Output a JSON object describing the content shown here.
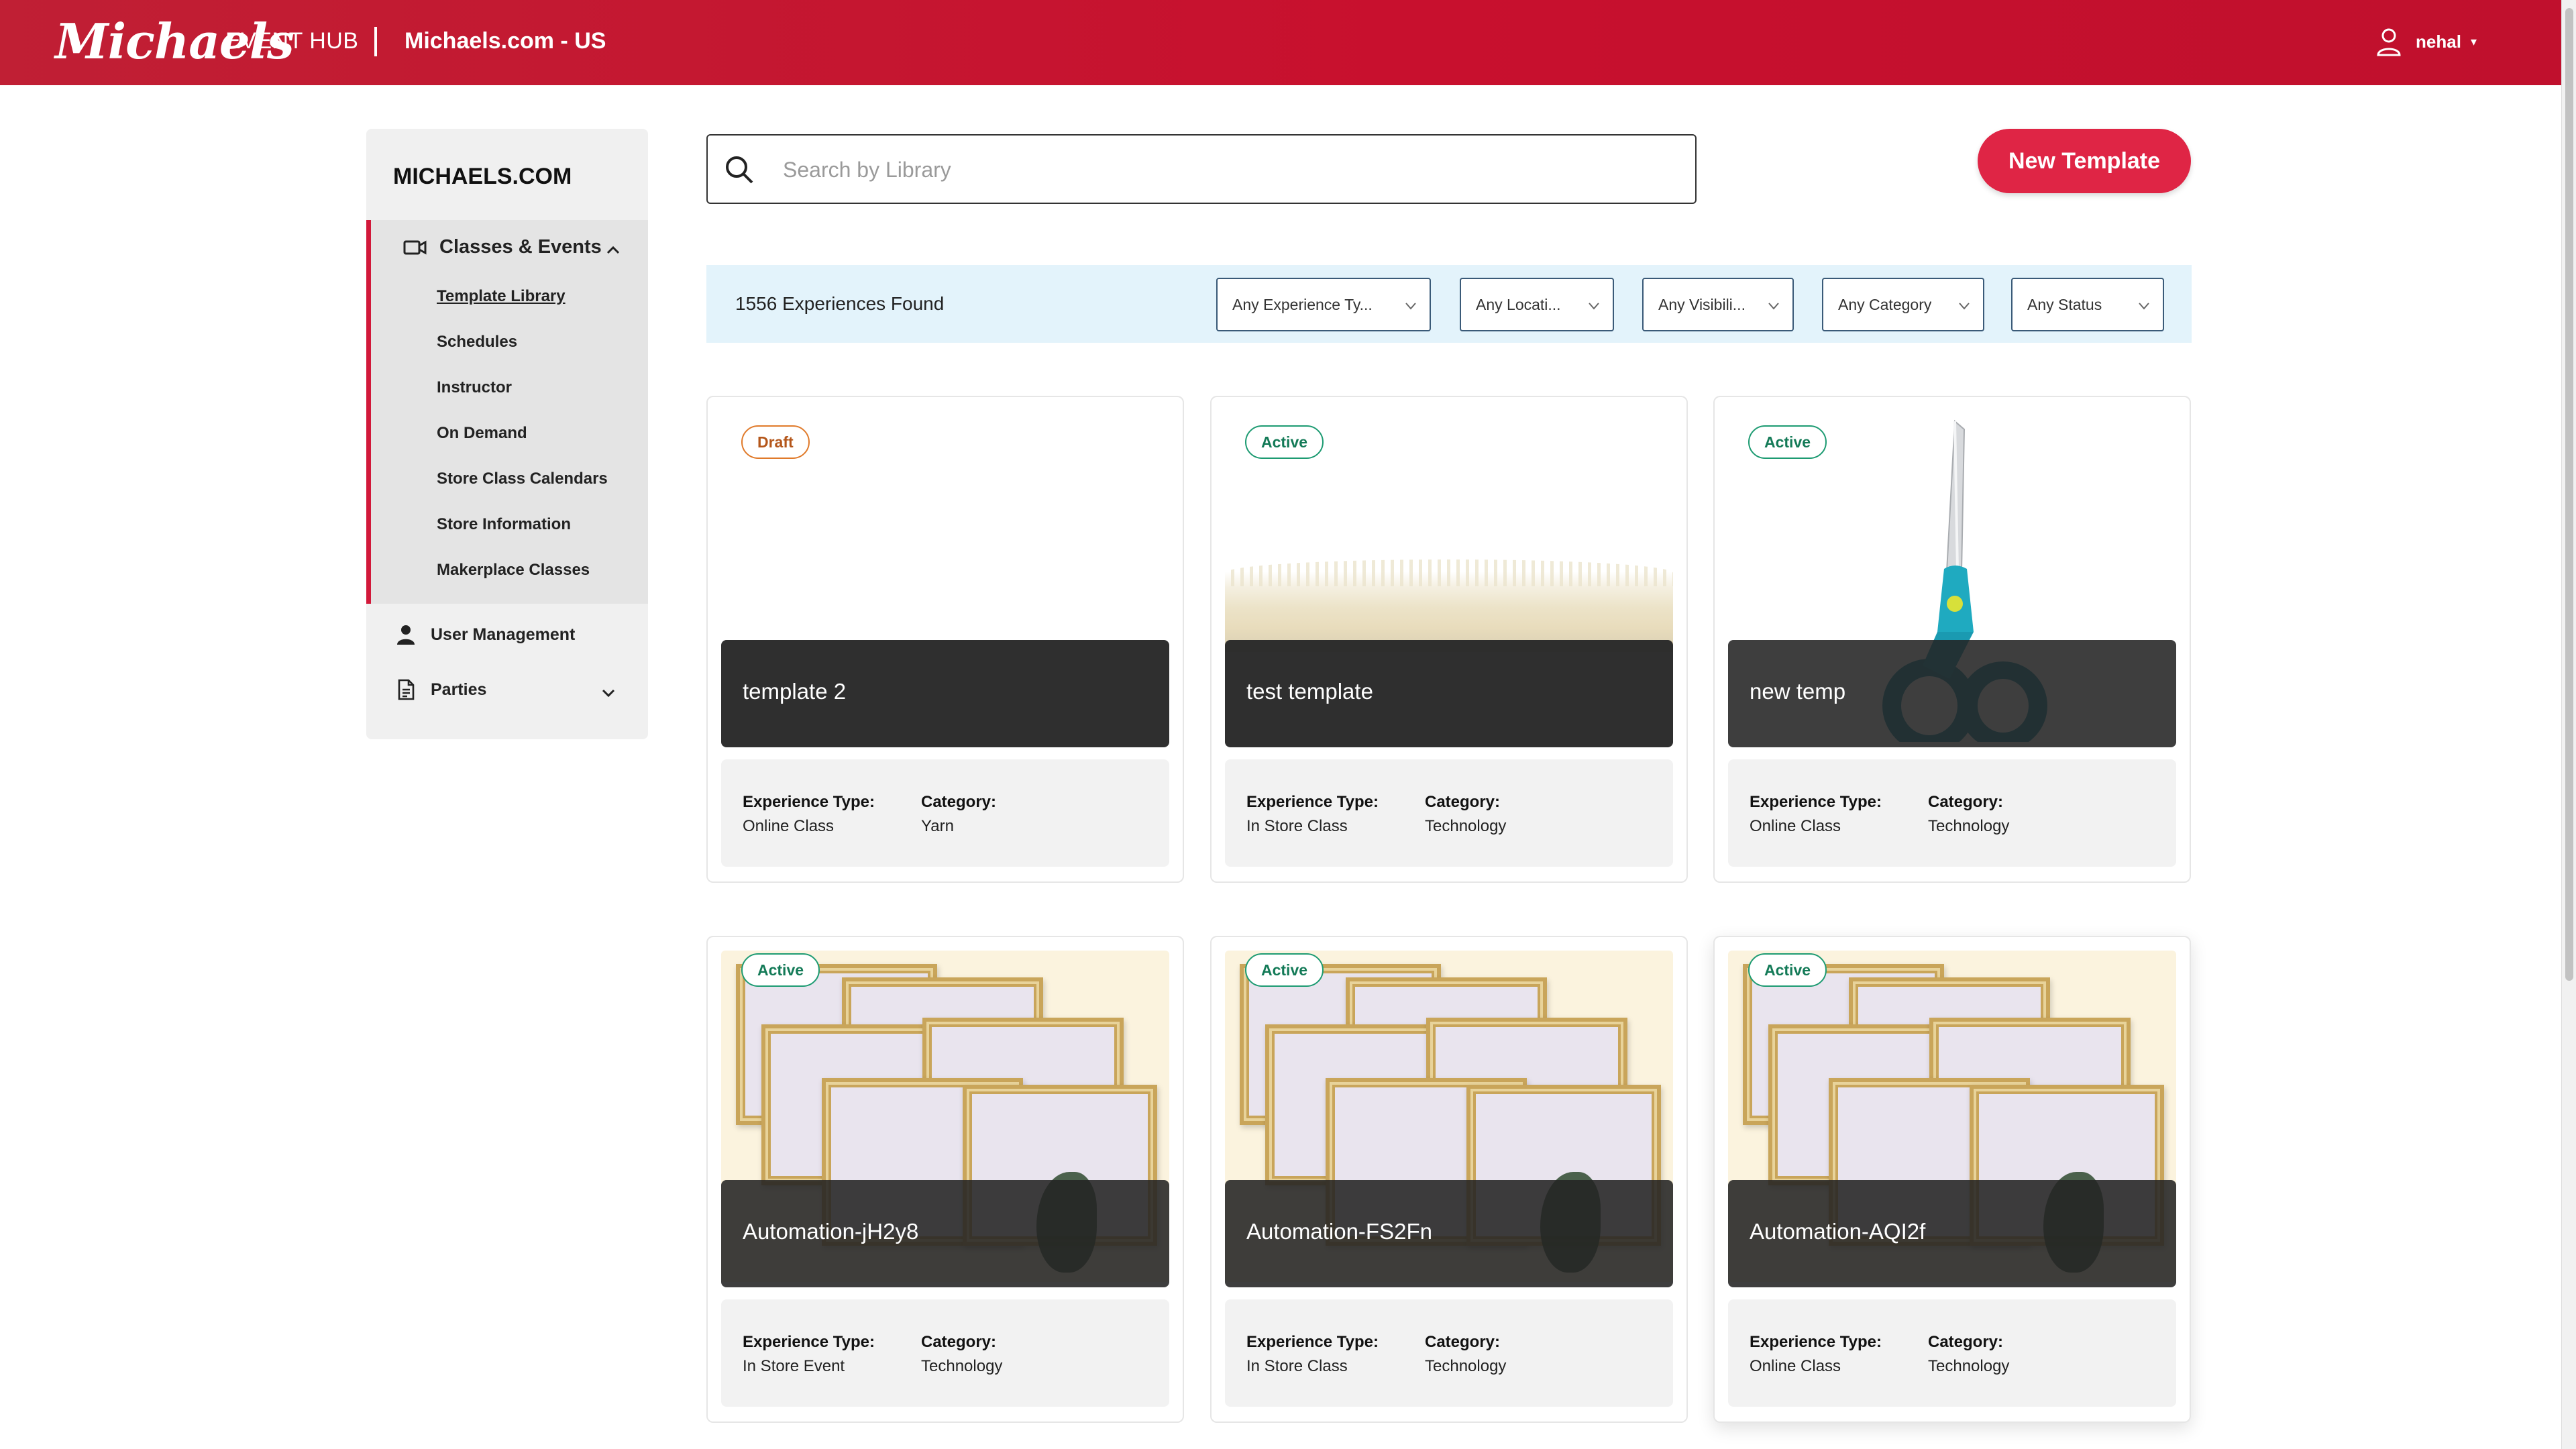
{
  "header": {
    "logo": "Michaels",
    "app_name": "EVENT HUB",
    "site": "Michaels.com - US",
    "user": "nehal"
  },
  "sidebar": {
    "title": "MICHAELS.COM",
    "section": {
      "label": "Classes & Events",
      "items": [
        {
          "label": "Template Library",
          "active": true
        },
        {
          "label": "Schedules"
        },
        {
          "label": "Instructor"
        },
        {
          "label": "On Demand"
        },
        {
          "label": "Store Class Calendars"
        },
        {
          "label": "Store Information"
        },
        {
          "label": "Makerplace Classes"
        }
      ]
    },
    "user_management": "User Management",
    "parties": "Parties"
  },
  "search": {
    "placeholder": "Search by Library",
    "value": ""
  },
  "new_template_button": "New Template",
  "filters": {
    "found_text": "1556 Experiences Found",
    "dropdowns": [
      {
        "label": "Any Experience Ty..."
      },
      {
        "label": "Any Locati..."
      },
      {
        "label": "Any Visibili..."
      },
      {
        "label": "Any Category"
      },
      {
        "label": "Any Status"
      }
    ]
  },
  "card_labels": {
    "experience_type": "Experience Type:",
    "category": "Category:"
  },
  "cards": [
    {
      "status": "Draft",
      "title": "template 2",
      "experience_type": "Online Class",
      "category": "Yarn",
      "image": "blank"
    },
    {
      "status": "Active",
      "title": "test template",
      "experience_type": "In Store Class",
      "category": "Technology",
      "image": "fleece"
    },
    {
      "status": "Active",
      "title": "new temp",
      "experience_type": "Online Class",
      "category": "Technology",
      "image": "scissors"
    },
    {
      "status": "Active",
      "title": "Automation-jH2y8",
      "experience_type": "In Store Event",
      "category": "Technology",
      "image": "frames"
    },
    {
      "status": "Active",
      "title": "Automation-FS2Fn",
      "experience_type": "In Store Class",
      "category": "Technology",
      "image": "frames"
    },
    {
      "status": "Active",
      "title": "Automation-AQI2f",
      "experience_type": "Online Class",
      "category": "Technology",
      "image": "frames"
    }
  ],
  "colors": {
    "brand_red": "#c8102e",
    "button_red": "#df2545",
    "active_green": "#1d9b72",
    "draft_orange": "#e07a2a",
    "filter_bg": "#e3f3fb"
  }
}
